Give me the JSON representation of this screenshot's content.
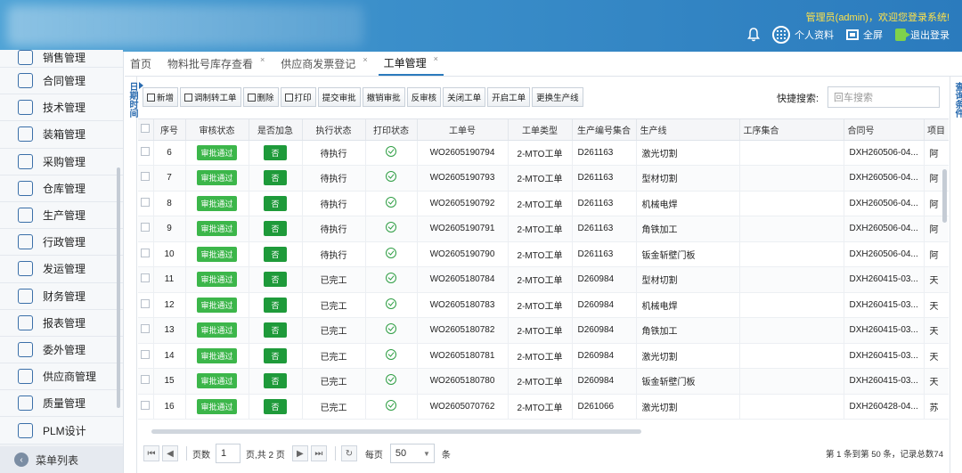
{
  "header": {
    "welcome": "管理员(admin)，欢迎您登录系统!",
    "profile_label": "个人资料",
    "fullscreen_label": "全屏",
    "logout_label": "退出登录"
  },
  "sidebar": {
    "items": [
      {
        "label": "销售管理",
        "icon": "sales-icon"
      },
      {
        "label": "合同管理",
        "icon": "contract-icon"
      },
      {
        "label": "技术管理",
        "icon": "tools-icon"
      },
      {
        "label": "装箱管理",
        "icon": "box-icon"
      },
      {
        "label": "采购管理",
        "icon": "purchase-icon"
      },
      {
        "label": "仓库管理",
        "icon": "warehouse-icon"
      },
      {
        "label": "生产管理",
        "icon": "production-icon"
      },
      {
        "label": "行政管理",
        "icon": "admin-icon"
      },
      {
        "label": "发运管理",
        "icon": "shipping-icon"
      },
      {
        "label": "财务管理",
        "icon": "finance-icon"
      },
      {
        "label": "报表管理",
        "icon": "report-icon"
      },
      {
        "label": "委外管理",
        "icon": "outsource-icon"
      },
      {
        "label": "供应商管理",
        "icon": "supplier-icon"
      },
      {
        "label": "质量管理",
        "icon": "quality-icon"
      },
      {
        "label": "PLM设计",
        "icon": "plm-icon"
      }
    ],
    "menu_list": "菜单列表"
  },
  "tabs": [
    {
      "label": "首页",
      "closable": false
    },
    {
      "label": "物料批号库存查看",
      "closable": true
    },
    {
      "label": "供应商发票登记",
      "closable": true
    },
    {
      "label": "工单管理",
      "closable": true,
      "active": true
    }
  ],
  "left_strip_label": "日期时间",
  "right_strip_label": "查询条件",
  "toolbar": {
    "buttons": [
      "新增",
      "调制转工单",
      "删除",
      "打印",
      "提交审批",
      "撤销审批",
      "反审核",
      "关闭工单",
      "开启工单",
      "更换生产线"
    ],
    "quick_search_label": "快捷搜索:",
    "quick_search_placeholder": "回车搜索"
  },
  "table": {
    "columns": [
      "序号",
      "审核状态",
      "是否加急",
      "执行状态",
      "打印状态",
      "工单号",
      "工单类型",
      "生产编号集合",
      "生产线",
      "工序集合",
      "合同号",
      "项目"
    ],
    "rows": [
      {
        "no": "6",
        "audit": "审批通过",
        "urgent": "否",
        "exec": "待执行",
        "wo": "WO2605190794",
        "type": "2-MTO工单",
        "prod": "D261163",
        "line": "激光切割",
        "proc": "",
        "contract": "DXH260506-04...",
        "proj": "阿"
      },
      {
        "no": "7",
        "audit": "审批通过",
        "urgent": "否",
        "exec": "待执行",
        "wo": "WO2605190793",
        "type": "2-MTO工单",
        "prod": "D261163",
        "line": "型材切割",
        "proc": "",
        "contract": "DXH260506-04...",
        "proj": "阿"
      },
      {
        "no": "8",
        "audit": "审批通过",
        "urgent": "否",
        "exec": "待执行",
        "wo": "WO2605190792",
        "type": "2-MTO工单",
        "prod": "D261163",
        "line": "机械电焊",
        "proc": "",
        "contract": "DXH260506-04...",
        "proj": "阿"
      },
      {
        "no": "9",
        "audit": "审批通过",
        "urgent": "否",
        "exec": "待执行",
        "wo": "WO2605190791",
        "type": "2-MTO工单",
        "prod": "D261163",
        "line": "角铁加工",
        "proc": "",
        "contract": "DXH260506-04...",
        "proj": "阿"
      },
      {
        "no": "10",
        "audit": "审批通过",
        "urgent": "否",
        "exec": "待执行",
        "wo": "WO2605190790",
        "type": "2-MTO工单",
        "prod": "D261163",
        "line": "钣金斩壁门板",
        "proc": "",
        "contract": "DXH260506-04...",
        "proj": "阿"
      },
      {
        "no": "11",
        "audit": "审批通过",
        "urgent": "否",
        "exec": "已完工",
        "wo": "WO2605180784",
        "type": "2-MTO工单",
        "prod": "D260984",
        "line": "型材切割",
        "proc": "",
        "contract": "DXH260415-03...",
        "proj": "天"
      },
      {
        "no": "12",
        "audit": "审批通过",
        "urgent": "否",
        "exec": "已完工",
        "wo": "WO2605180783",
        "type": "2-MTO工单",
        "prod": "D260984",
        "line": "机械电焊",
        "proc": "",
        "contract": "DXH260415-03...",
        "proj": "天"
      },
      {
        "no": "13",
        "audit": "审批通过",
        "urgent": "否",
        "exec": "已完工",
        "wo": "WO2605180782",
        "type": "2-MTO工单",
        "prod": "D260984",
        "line": "角铁加工",
        "proc": "",
        "contract": "DXH260415-03...",
        "proj": "天"
      },
      {
        "no": "14",
        "audit": "审批通过",
        "urgent": "否",
        "exec": "已完工",
        "wo": "WO2605180781",
        "type": "2-MTO工单",
        "prod": "D260984",
        "line": "激光切割",
        "proc": "",
        "contract": "DXH260415-03...",
        "proj": "天"
      },
      {
        "no": "15",
        "audit": "审批通过",
        "urgent": "否",
        "exec": "已完工",
        "wo": "WO2605180780",
        "type": "2-MTO工单",
        "prod": "D260984",
        "line": "钣金斩壁门板",
        "proc": "",
        "contract": "DXH260415-03...",
        "proj": "天"
      },
      {
        "no": "16",
        "audit": "审批通过",
        "urgent": "否",
        "exec": "已完工",
        "wo": "WO2605070762",
        "type": "2-MTO工单",
        "prod": "D261066",
        "line": "激光切割",
        "proc": "",
        "contract": "DXH260428-04...",
        "proj": "苏"
      }
    ]
  },
  "pager": {
    "page_label": "页数",
    "page_value": "1",
    "total_pages": "页,共 2 页",
    "per_page_label": "每页",
    "per_page_value": "50",
    "unit": "条",
    "info": "第 1 条到第 50 条，记录总数74"
  }
}
